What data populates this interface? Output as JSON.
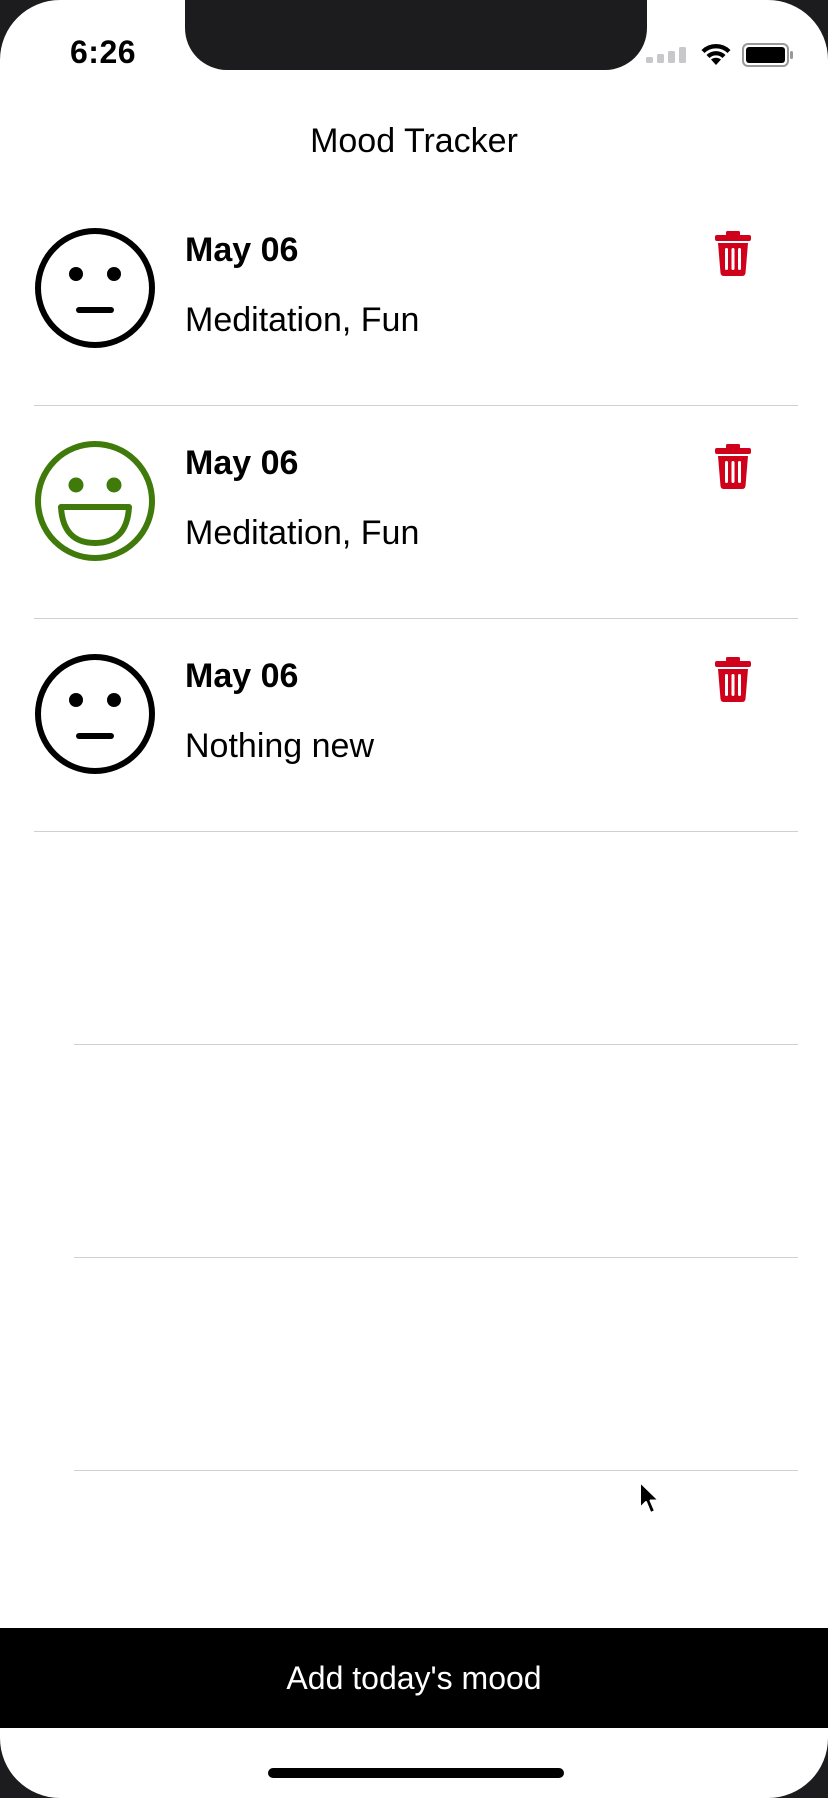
{
  "status_bar": {
    "time": "6:26"
  },
  "nav": {
    "title": "Mood Tracker"
  },
  "entries": [
    {
      "date": "May 06",
      "activities": "Meditation, Fun",
      "mood": "neutral",
      "color": "#000000"
    },
    {
      "date": "May 06",
      "activities": "Meditation, Fun",
      "mood": "happy",
      "color": "#3f7a0a"
    },
    {
      "date": "May 06",
      "activities": "Nothing new",
      "mood": "neutral",
      "color": "#000000"
    }
  ],
  "icons": {
    "delete": "trash-icon",
    "neutral": "neutral-face-icon",
    "happy": "happy-face-icon"
  },
  "colors": {
    "delete": "#d0021b",
    "happy": "#3f7a0a",
    "button_bg": "#000000"
  },
  "footer": {
    "add_label": "Add today's mood"
  }
}
